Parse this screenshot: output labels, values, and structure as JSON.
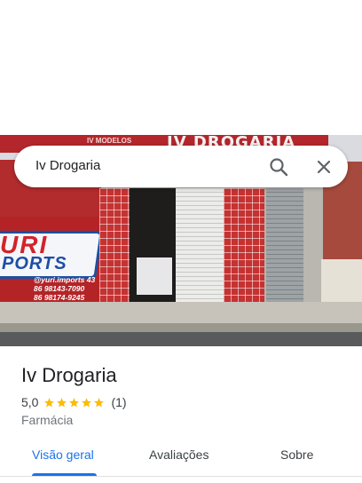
{
  "search": {
    "query": "Iv Drogaria",
    "search_icon": "search-icon",
    "close_icon": "close-icon"
  },
  "photo": {
    "storefront_sign": "IV DROGARIA",
    "small_sign": "IV MODELOS",
    "logo_top": "URI",
    "logo_bottom": "PORTS",
    "instagram": "@yuri.imports 43",
    "phone_1": "86 98143-7090",
    "phone_2": "86 98174-9245"
  },
  "place": {
    "name": "Iv Drogaria",
    "rating": "5,0",
    "stars": 5,
    "reviews": "(1)",
    "category": "Farmácia"
  },
  "tabs": [
    {
      "label": "Visão geral",
      "active": true
    },
    {
      "label": "Avaliações",
      "active": false
    },
    {
      "label": "Sobre",
      "active": false
    }
  ],
  "colors": {
    "accent": "#1a73e8",
    "star": "#fbbc04",
    "text_primary": "#202124",
    "text_secondary": "#70757a"
  }
}
